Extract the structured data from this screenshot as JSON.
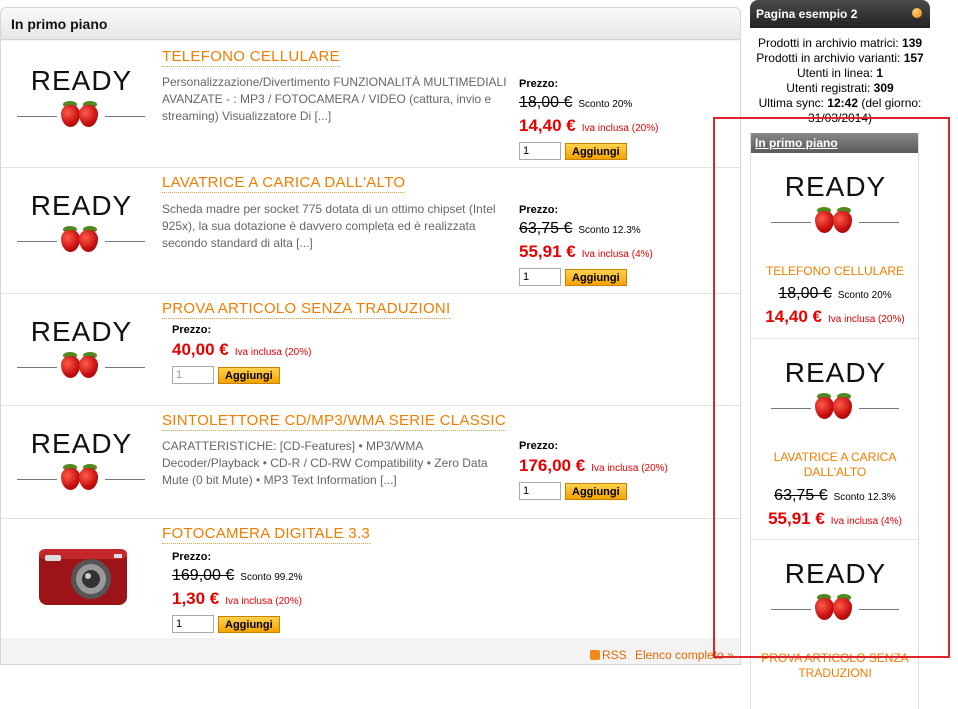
{
  "main": {
    "title": "In primo piano",
    "products": [
      {
        "title": "TELEFONO CELLULARE",
        "desc": "Personalizzazione/Divertimento FUNZIONALITÀ MULTIMEDIALI AVANZATE - : MP3 / FOTOCAMERA / VIDEO (cattura, invio e streaming) Visualizzatore Di [...]",
        "price_label": "Prezzo:",
        "old_price": "18,00 €",
        "discount": "Sconto 20%",
        "new_price": "14,40 €",
        "vat": "Iva inclusa (20%)",
        "qty": "1",
        "add": "Aggiungi",
        "image": "ready-logo"
      },
      {
        "title": "LAVATRICE A CARICA DALL'ALTO",
        "desc": "Scheda madre per socket 775 dotata di un ottimo chipset (Intel 925x), la sua dotazione è davvero completa ed è realizzata secondo standard di alta [...]",
        "price_label": "Prezzo:",
        "old_price": "63,75 €",
        "discount": "Sconto 12.3%",
        "new_price": "55,91 €",
        "vat": "Iva inclusa (4%)",
        "qty": "1",
        "add": "Aggiungi",
        "image": "ready-logo"
      },
      {
        "title": "PROVA ARTICOLO SENZA TRADUZIONI",
        "desc": "",
        "price_label": "Prezzo:",
        "new_price": "40,00 €",
        "vat": "Iva inclusa (20%)",
        "qty": "1",
        "add": "Aggiungi",
        "image": "ready-logo"
      },
      {
        "title": "SINTOLETTORE CD/MP3/WMA SERIE CLASSIC",
        "desc": "CARATTERISTICHE: [CD-Features] • MP3/WMA Decoder/Playback • CD-R / CD-RW Compatibility • Zero Data Mute (0 bit Mute) • MP3 Text Information [...]",
        "price_label": "Prezzo:",
        "new_price": "176,00 €",
        "vat": "Iva inclusa (20%)",
        "qty": "1",
        "add": "Aggiungi",
        "image": "ready-logo"
      },
      {
        "title": "FOTOCAMERA DIGITALE 3.3",
        "desc": "",
        "price_label": "Prezzo:",
        "old_price": "169,00 €",
        "discount": "Sconto 99.2%",
        "new_price": "1,30 €",
        "vat": "Iva inclusa (20%)",
        "qty": "1",
        "add": "Aggiungi",
        "image": "camera-photo"
      }
    ],
    "footer": {
      "rss": "RSS",
      "all": "Elenco completo »"
    }
  },
  "logo_text": "READY",
  "sidebar": {
    "title": "Pagina esempio 2",
    "stats": {
      "l1": "Prodotti in archivio matrici:",
      "v1": "139",
      "l2": "Prodotti in archivio varianti:",
      "v2": "157",
      "l3": "Utenti in linea:",
      "v3": "1",
      "l4": "Utenti registrati:",
      "v4": "309",
      "l5": "Ultima sync:",
      "v5": "12:42",
      "l6": "(del giorno:",
      "v6": "31/03/2014)"
    },
    "box_title": "In primo piano",
    "items": [
      {
        "title": "TELEFONO CELLULARE",
        "old_price": "18,00 €",
        "discount": "Sconto 20%",
        "new_price": "14,40 €",
        "vat": "Iva inclusa (20%)"
      },
      {
        "title": "LAVATRICE A CARICA DALL'ALTO",
        "old_price": "63,75 €",
        "discount": "Sconto 12.3%",
        "new_price": "55,91 €",
        "vat": "Iva inclusa (4%)"
      },
      {
        "title": "PROVA ARTICOLO SENZA TRADUZIONI"
      }
    ]
  },
  "colors": {
    "accent": "#f07d00",
    "price": "#e60000",
    "highlight": "#e0232a"
  }
}
